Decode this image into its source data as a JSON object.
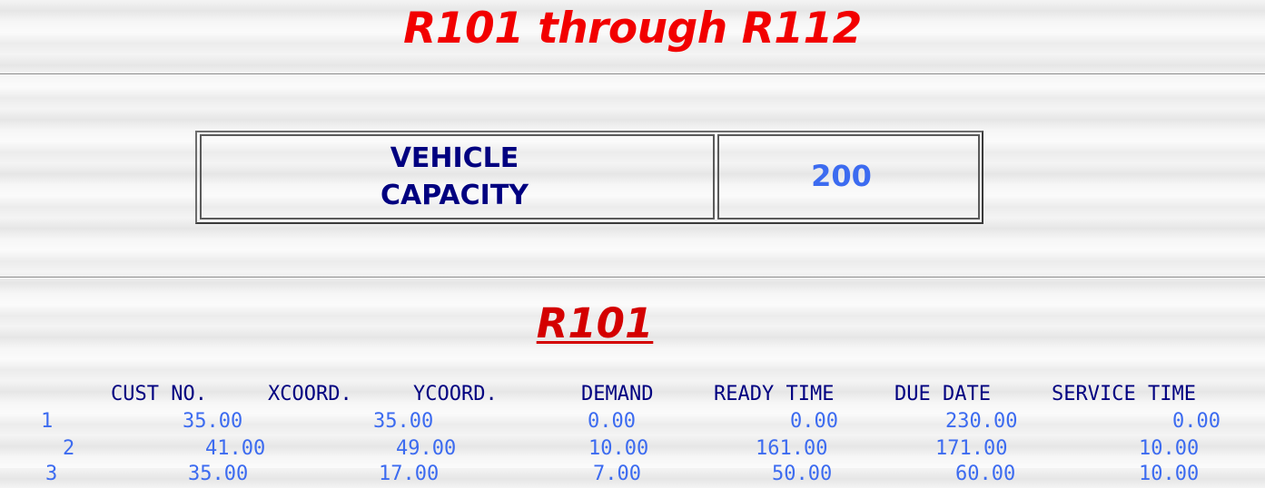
{
  "page": {
    "title": "R101 through R112"
  },
  "capacity": {
    "label_line1": "VEHICLE",
    "label_line2": "CAPACITY",
    "value": "200"
  },
  "section": {
    "title": "R101"
  },
  "table": {
    "headers": [
      "CUST NO.",
      "XCOORD.",
      "YCOORD.",
      "DEMAND",
      "READY TIME",
      "DUE DATE",
      "SERVICE TIME"
    ],
    "rows": [
      [
        "1",
        "35.00",
        "35.00",
        "0.00",
        "0.00",
        "230.00",
        "0.00"
      ],
      [
        "2",
        "41.00",
        "49.00",
        "10.00",
        "161.00",
        "171.00",
        "10.00"
      ],
      [
        "3",
        "35.00",
        "17.00",
        "7.00",
        "50.00",
        "60.00",
        "10.00"
      ]
    ]
  }
}
